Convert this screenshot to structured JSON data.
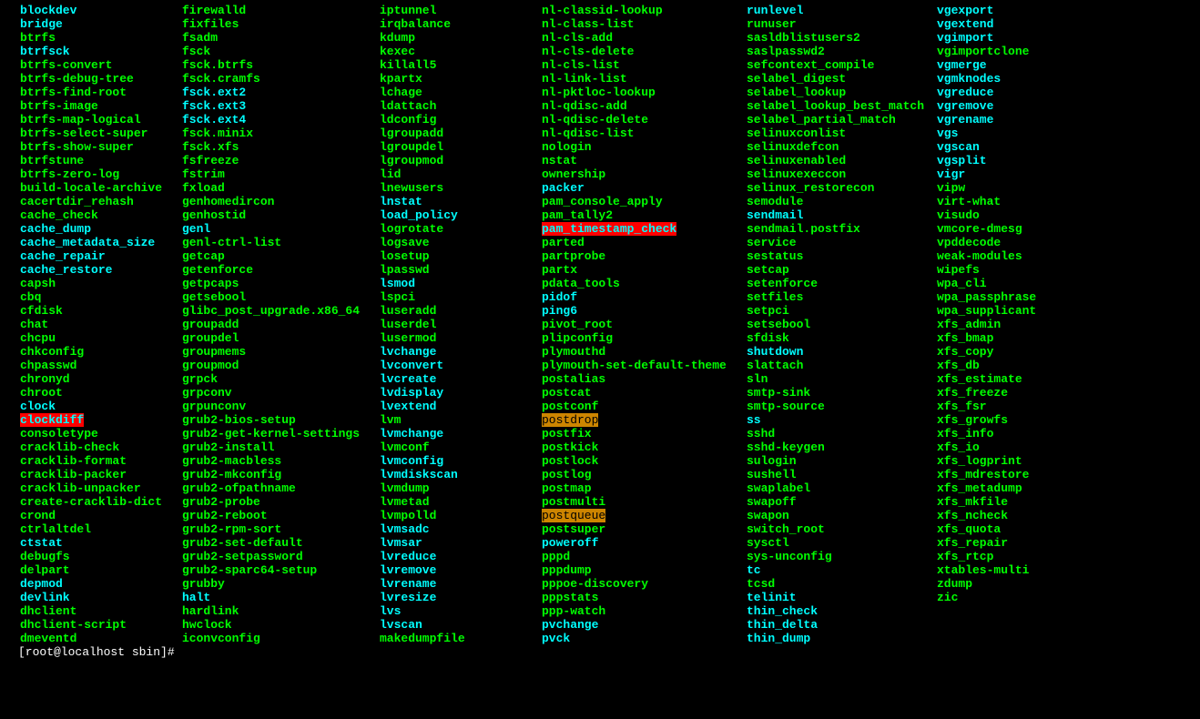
{
  "prompt": "[root@localhost sbin]#",
  "columns": [
    [
      {
        "t": "blockdev",
        "c": "cyan-bold"
      },
      {
        "t": "bridge",
        "c": "cyan-bold"
      },
      {
        "t": "btrfs",
        "c": "green-bold"
      },
      {
        "t": "btrfsck",
        "c": "cyan-bold"
      },
      {
        "t": "btrfs-convert",
        "c": "green-bold"
      },
      {
        "t": "btrfs-debug-tree",
        "c": "green-bold"
      },
      {
        "t": "btrfs-find-root",
        "c": "green-bold"
      },
      {
        "t": "btrfs-image",
        "c": "green-bold"
      },
      {
        "t": "btrfs-map-logical",
        "c": "green-bold"
      },
      {
        "t": "btrfs-select-super",
        "c": "green-bold"
      },
      {
        "t": "btrfs-show-super",
        "c": "green-bold"
      },
      {
        "t": "btrfstune",
        "c": "green-bold"
      },
      {
        "t": "btrfs-zero-log",
        "c": "green-bold"
      },
      {
        "t": "build-locale-archive",
        "c": "green-bold"
      },
      {
        "t": "cacertdir_rehash",
        "c": "green-bold"
      },
      {
        "t": "cache_check",
        "c": "green-bold"
      },
      {
        "t": "cache_dump",
        "c": "cyan-bold"
      },
      {
        "t": "cache_metadata_size",
        "c": "cyan-bold"
      },
      {
        "t": "cache_repair",
        "c": "cyan-bold"
      },
      {
        "t": "cache_restore",
        "c": "cyan-bold"
      },
      {
        "t": "capsh",
        "c": "green-bold"
      },
      {
        "t": "cbq",
        "c": "green-bold"
      },
      {
        "t": "cfdisk",
        "c": "green-bold"
      },
      {
        "t": "chat",
        "c": "green-bold"
      },
      {
        "t": "chcpu",
        "c": "green-bold"
      },
      {
        "t": "chkconfig",
        "c": "green-bold"
      },
      {
        "t": "chpasswd",
        "c": "green-bold"
      },
      {
        "t": "chronyd",
        "c": "green-bold"
      },
      {
        "t": "chroot",
        "c": "green-bold"
      },
      {
        "t": "clock",
        "c": "cyan-bold"
      },
      {
        "t": "clockdiff",
        "c": "cyan-bold",
        "bg": "on-red"
      },
      {
        "t": "consoletype",
        "c": "green-bold"
      },
      {
        "t": "cracklib-check",
        "c": "green-bold"
      },
      {
        "t": "cracklib-format",
        "c": "green-bold"
      },
      {
        "t": "cracklib-packer",
        "c": "green-bold"
      },
      {
        "t": "cracklib-unpacker",
        "c": "green-bold"
      },
      {
        "t": "create-cracklib-dict",
        "c": "green-bold"
      },
      {
        "t": "crond",
        "c": "green-bold"
      },
      {
        "t": "ctrlaltdel",
        "c": "green-bold"
      },
      {
        "t": "ctstat",
        "c": "cyan-bold"
      },
      {
        "t": "debugfs",
        "c": "green-bold"
      },
      {
        "t": "delpart",
        "c": "green-bold"
      },
      {
        "t": "depmod",
        "c": "cyan-bold"
      },
      {
        "t": "devlink",
        "c": "cyan-bold"
      },
      {
        "t": "dhclient",
        "c": "green-bold"
      },
      {
        "t": "dhclient-script",
        "c": "green-bold"
      },
      {
        "t": "dmeventd",
        "c": "green-bold"
      }
    ],
    [
      {
        "t": "firewalld",
        "c": "green-bold"
      },
      {
        "t": "fixfiles",
        "c": "green-bold"
      },
      {
        "t": "fsadm",
        "c": "green-bold"
      },
      {
        "t": "fsck",
        "c": "green-bold"
      },
      {
        "t": "fsck.btrfs",
        "c": "green-bold"
      },
      {
        "t": "fsck.cramfs",
        "c": "green-bold"
      },
      {
        "t": "fsck.ext2",
        "c": "cyan-bold"
      },
      {
        "t": "fsck.ext3",
        "c": "cyan-bold"
      },
      {
        "t": "fsck.ext4",
        "c": "cyan-bold"
      },
      {
        "t": "fsck.minix",
        "c": "green-bold"
      },
      {
        "t": "fsck.xfs",
        "c": "green-bold"
      },
      {
        "t": "fsfreeze",
        "c": "green-bold"
      },
      {
        "t": "fstrim",
        "c": "green-bold"
      },
      {
        "t": "fxload",
        "c": "green-bold"
      },
      {
        "t": "genhomedircon",
        "c": "green-bold"
      },
      {
        "t": "genhostid",
        "c": "green-bold"
      },
      {
        "t": "genl",
        "c": "cyan-bold"
      },
      {
        "t": "genl-ctrl-list",
        "c": "green-bold"
      },
      {
        "t": "getcap",
        "c": "green-bold"
      },
      {
        "t": "getenforce",
        "c": "green-bold"
      },
      {
        "t": "getpcaps",
        "c": "green-bold"
      },
      {
        "t": "getsebool",
        "c": "green-bold"
      },
      {
        "t": "glibc_post_upgrade.x86_64",
        "c": "green-bold"
      },
      {
        "t": "groupadd",
        "c": "green-bold"
      },
      {
        "t": "groupdel",
        "c": "green-bold"
      },
      {
        "t": "groupmems",
        "c": "green-bold"
      },
      {
        "t": "groupmod",
        "c": "green-bold"
      },
      {
        "t": "grpck",
        "c": "green-bold"
      },
      {
        "t": "grpconv",
        "c": "green-bold"
      },
      {
        "t": "grpunconv",
        "c": "green-bold"
      },
      {
        "t": "grub2-bios-setup",
        "c": "green-bold"
      },
      {
        "t": "grub2-get-kernel-settings",
        "c": "green-bold"
      },
      {
        "t": "grub2-install",
        "c": "green-bold"
      },
      {
        "t": "grub2-macbless",
        "c": "green-bold"
      },
      {
        "t": "grub2-mkconfig",
        "c": "green-bold"
      },
      {
        "t": "grub2-ofpathname",
        "c": "green-bold"
      },
      {
        "t": "grub2-probe",
        "c": "green-bold"
      },
      {
        "t": "grub2-reboot",
        "c": "green-bold"
      },
      {
        "t": "grub2-rpm-sort",
        "c": "green-bold"
      },
      {
        "t": "grub2-set-default",
        "c": "green-bold"
      },
      {
        "t": "grub2-setpassword",
        "c": "green-bold"
      },
      {
        "t": "grub2-sparc64-setup",
        "c": "green-bold"
      },
      {
        "t": "grubby",
        "c": "green-bold"
      },
      {
        "t": "halt",
        "c": "cyan-bold"
      },
      {
        "t": "hardlink",
        "c": "green-bold"
      },
      {
        "t": "hwclock",
        "c": "green-bold"
      },
      {
        "t": "iconvconfig",
        "c": "green-bold"
      }
    ],
    [
      {
        "t": "iptunnel",
        "c": "green-bold"
      },
      {
        "t": "irqbalance",
        "c": "green-bold"
      },
      {
        "t": "kdump",
        "c": "green-bold"
      },
      {
        "t": "kexec",
        "c": "green-bold"
      },
      {
        "t": "killall5",
        "c": "green-bold"
      },
      {
        "t": "kpartx",
        "c": "green-bold"
      },
      {
        "t": "lchage",
        "c": "green-bold"
      },
      {
        "t": "ldattach",
        "c": "green-bold"
      },
      {
        "t": "ldconfig",
        "c": "green-bold"
      },
      {
        "t": "lgroupadd",
        "c": "green-bold"
      },
      {
        "t": "lgroupdel",
        "c": "green-bold"
      },
      {
        "t": "lgroupmod",
        "c": "green-bold"
      },
      {
        "t": "lid",
        "c": "green-bold"
      },
      {
        "t": "lnewusers",
        "c": "green-bold"
      },
      {
        "t": "lnstat",
        "c": "cyan-bold"
      },
      {
        "t": "load_policy",
        "c": "cyan-bold"
      },
      {
        "t": "logrotate",
        "c": "green-bold"
      },
      {
        "t": "logsave",
        "c": "green-bold"
      },
      {
        "t": "losetup",
        "c": "green-bold"
      },
      {
        "t": "lpasswd",
        "c": "green-bold"
      },
      {
        "t": "lsmod",
        "c": "cyan-bold"
      },
      {
        "t": "lspci",
        "c": "green-bold"
      },
      {
        "t": "luseradd",
        "c": "green-bold"
      },
      {
        "t": "luserdel",
        "c": "green-bold"
      },
      {
        "t": "lusermod",
        "c": "green-bold"
      },
      {
        "t": "lvchange",
        "c": "cyan-bold"
      },
      {
        "t": "lvconvert",
        "c": "cyan-bold"
      },
      {
        "t": "lvcreate",
        "c": "cyan-bold"
      },
      {
        "t": "lvdisplay",
        "c": "cyan-bold"
      },
      {
        "t": "lvextend",
        "c": "cyan-bold"
      },
      {
        "t": "lvm",
        "c": "green-bold"
      },
      {
        "t": "lvmchange",
        "c": "cyan-bold"
      },
      {
        "t": "lvmconf",
        "c": "green-bold"
      },
      {
        "t": "lvmconfig",
        "c": "cyan-bold"
      },
      {
        "t": "lvmdiskscan",
        "c": "cyan-bold"
      },
      {
        "t": "lvmdump",
        "c": "green-bold"
      },
      {
        "t": "lvmetad",
        "c": "green-bold"
      },
      {
        "t": "lvmpolld",
        "c": "green-bold"
      },
      {
        "t": "lvmsadc",
        "c": "cyan-bold"
      },
      {
        "t": "lvmsar",
        "c": "cyan-bold"
      },
      {
        "t": "lvreduce",
        "c": "cyan-bold"
      },
      {
        "t": "lvremove",
        "c": "cyan-bold"
      },
      {
        "t": "lvrename",
        "c": "cyan-bold"
      },
      {
        "t": "lvresize",
        "c": "cyan-bold"
      },
      {
        "t": "lvs",
        "c": "cyan-bold"
      },
      {
        "t": "lvscan",
        "c": "cyan-bold"
      },
      {
        "t": "makedumpfile",
        "c": "green-bold"
      }
    ],
    [
      {
        "t": "nl-classid-lookup",
        "c": "green-bold"
      },
      {
        "t": "nl-class-list",
        "c": "green-bold"
      },
      {
        "t": "nl-cls-add",
        "c": "green-bold"
      },
      {
        "t": "nl-cls-delete",
        "c": "green-bold"
      },
      {
        "t": "nl-cls-list",
        "c": "green-bold"
      },
      {
        "t": "nl-link-list",
        "c": "green-bold"
      },
      {
        "t": "nl-pktloc-lookup",
        "c": "green-bold"
      },
      {
        "t": "nl-qdisc-add",
        "c": "green-bold"
      },
      {
        "t": "nl-qdisc-delete",
        "c": "green-bold"
      },
      {
        "t": "nl-qdisc-list",
        "c": "green-bold"
      },
      {
        "t": "nologin",
        "c": "green-bold"
      },
      {
        "t": "nstat",
        "c": "green-bold"
      },
      {
        "t": "ownership",
        "c": "green-bold"
      },
      {
        "t": "packer",
        "c": "cyan-bold"
      },
      {
        "t": "pam_console_apply",
        "c": "green-bold"
      },
      {
        "t": "pam_tally2",
        "c": "green-bold"
      },
      {
        "t": "pam_timestamp_check",
        "c": "cyan-bold",
        "bg": "on-red"
      },
      {
        "t": "parted",
        "c": "green-bold"
      },
      {
        "t": "partprobe",
        "c": "green-bold"
      },
      {
        "t": "partx",
        "c": "green-bold"
      },
      {
        "t": "pdata_tools",
        "c": "green-bold"
      },
      {
        "t": "pidof",
        "c": "cyan-bold"
      },
      {
        "t": "ping6",
        "c": "cyan-bold"
      },
      {
        "t": "pivot_root",
        "c": "green-bold"
      },
      {
        "t": "plipconfig",
        "c": "green-bold"
      },
      {
        "t": "plymouthd",
        "c": "green-bold"
      },
      {
        "t": "plymouth-set-default-theme",
        "c": "green-bold"
      },
      {
        "t": "postalias",
        "c": "green-bold"
      },
      {
        "t": "postcat",
        "c": "green-bold"
      },
      {
        "t": "postconf",
        "c": "green-bold"
      },
      {
        "t": "postdrop",
        "c": "",
        "bg": "on-orange"
      },
      {
        "t": "postfix",
        "c": "green-bold"
      },
      {
        "t": "postkick",
        "c": "green-bold"
      },
      {
        "t": "postlock",
        "c": "green-bold"
      },
      {
        "t": "postlog",
        "c": "green-bold"
      },
      {
        "t": "postmap",
        "c": "green-bold"
      },
      {
        "t": "postmulti",
        "c": "green-bold"
      },
      {
        "t": "postqueue",
        "c": "",
        "bg": "on-orange"
      },
      {
        "t": "postsuper",
        "c": "green-bold"
      },
      {
        "t": "poweroff",
        "c": "cyan-bold"
      },
      {
        "t": "pppd",
        "c": "green-bold"
      },
      {
        "t": "pppdump",
        "c": "green-bold"
      },
      {
        "t": "pppoe-discovery",
        "c": "green-bold"
      },
      {
        "t": "pppstats",
        "c": "green-bold"
      },
      {
        "t": "ppp-watch",
        "c": "green-bold"
      },
      {
        "t": "pvchange",
        "c": "cyan-bold"
      },
      {
        "t": "pvck",
        "c": "cyan-bold"
      }
    ],
    [
      {
        "t": "runlevel",
        "c": "cyan-bold"
      },
      {
        "t": "runuser",
        "c": "green-bold"
      },
      {
        "t": "sasldblistusers2",
        "c": "green-bold"
      },
      {
        "t": "saslpasswd2",
        "c": "green-bold"
      },
      {
        "t": "sefcontext_compile",
        "c": "green-bold"
      },
      {
        "t": "selabel_digest",
        "c": "green-bold"
      },
      {
        "t": "selabel_lookup",
        "c": "green-bold"
      },
      {
        "t": "selabel_lookup_best_match",
        "c": "green-bold"
      },
      {
        "t": "selabel_partial_match",
        "c": "green-bold"
      },
      {
        "t": "selinuxconlist",
        "c": "green-bold"
      },
      {
        "t": "selinuxdefcon",
        "c": "green-bold"
      },
      {
        "t": "selinuxenabled",
        "c": "green-bold"
      },
      {
        "t": "selinuxexeccon",
        "c": "green-bold"
      },
      {
        "t": "selinux_restorecon",
        "c": "green-bold"
      },
      {
        "t": "semodule",
        "c": "green-bold"
      },
      {
        "t": "sendmail",
        "c": "cyan-bold"
      },
      {
        "t": "sendmail.postfix",
        "c": "green-bold"
      },
      {
        "t": "service",
        "c": "green-bold"
      },
      {
        "t": "sestatus",
        "c": "green-bold"
      },
      {
        "t": "setcap",
        "c": "green-bold"
      },
      {
        "t": "setenforce",
        "c": "green-bold"
      },
      {
        "t": "setfiles",
        "c": "green-bold"
      },
      {
        "t": "setpci",
        "c": "green-bold"
      },
      {
        "t": "setsebool",
        "c": "green-bold"
      },
      {
        "t": "sfdisk",
        "c": "green-bold"
      },
      {
        "t": "shutdown",
        "c": "cyan-bold"
      },
      {
        "t": "slattach",
        "c": "green-bold"
      },
      {
        "t": "sln",
        "c": "green-bold"
      },
      {
        "t": "smtp-sink",
        "c": "green-bold"
      },
      {
        "t": "smtp-source",
        "c": "green-bold"
      },
      {
        "t": "ss",
        "c": "cyan-bold"
      },
      {
        "t": "sshd",
        "c": "green-bold"
      },
      {
        "t": "sshd-keygen",
        "c": "green-bold"
      },
      {
        "t": "sulogin",
        "c": "green-bold"
      },
      {
        "t": "sushell",
        "c": "green-bold"
      },
      {
        "t": "swaplabel",
        "c": "green-bold"
      },
      {
        "t": "swapoff",
        "c": "green-bold"
      },
      {
        "t": "swapon",
        "c": "green-bold"
      },
      {
        "t": "switch_root",
        "c": "green-bold"
      },
      {
        "t": "sysctl",
        "c": "green-bold"
      },
      {
        "t": "sys-unconfig",
        "c": "green-bold"
      },
      {
        "t": "tc",
        "c": "cyan-bold"
      },
      {
        "t": "tcsd",
        "c": "green-bold"
      },
      {
        "t": "telinit",
        "c": "cyan-bold"
      },
      {
        "t": "thin_check",
        "c": "cyan-bold"
      },
      {
        "t": "thin_delta",
        "c": "cyan-bold"
      },
      {
        "t": "thin_dump",
        "c": "cyan-bold"
      }
    ],
    [
      {
        "t": "vgexport",
        "c": "cyan-bold"
      },
      {
        "t": "vgextend",
        "c": "cyan-bold"
      },
      {
        "t": "vgimport",
        "c": "cyan-bold"
      },
      {
        "t": "vgimportclone",
        "c": "green-bold"
      },
      {
        "t": "vgmerge",
        "c": "cyan-bold"
      },
      {
        "t": "vgmknodes",
        "c": "cyan-bold"
      },
      {
        "t": "vgreduce",
        "c": "cyan-bold"
      },
      {
        "t": "vgremove",
        "c": "cyan-bold"
      },
      {
        "t": "vgrename",
        "c": "cyan-bold"
      },
      {
        "t": "vgs",
        "c": "cyan-bold"
      },
      {
        "t": "vgscan",
        "c": "cyan-bold"
      },
      {
        "t": "vgsplit",
        "c": "cyan-bold"
      },
      {
        "t": "vigr",
        "c": "cyan-bold"
      },
      {
        "t": "vipw",
        "c": "green-bold"
      },
      {
        "t": "virt-what",
        "c": "green-bold"
      },
      {
        "t": "visudo",
        "c": "green-bold"
      },
      {
        "t": "vmcore-dmesg",
        "c": "green-bold"
      },
      {
        "t": "vpddecode",
        "c": "green-bold"
      },
      {
        "t": "weak-modules",
        "c": "green-bold"
      },
      {
        "t": "wipefs",
        "c": "green-bold"
      },
      {
        "t": "wpa_cli",
        "c": "green-bold"
      },
      {
        "t": "wpa_passphrase",
        "c": "green-bold"
      },
      {
        "t": "wpa_supplicant",
        "c": "green-bold"
      },
      {
        "t": "xfs_admin",
        "c": "green-bold"
      },
      {
        "t": "xfs_bmap",
        "c": "green-bold"
      },
      {
        "t": "xfs_copy",
        "c": "green-bold"
      },
      {
        "t": "xfs_db",
        "c": "green-bold"
      },
      {
        "t": "xfs_estimate",
        "c": "green-bold"
      },
      {
        "t": "xfs_freeze",
        "c": "green-bold"
      },
      {
        "t": "xfs_fsr",
        "c": "green-bold"
      },
      {
        "t": "xfs_growfs",
        "c": "green-bold"
      },
      {
        "t": "xfs_info",
        "c": "green-bold"
      },
      {
        "t": "xfs_io",
        "c": "green-bold"
      },
      {
        "t": "xfs_logprint",
        "c": "green-bold"
      },
      {
        "t": "xfs_mdrestore",
        "c": "green-bold"
      },
      {
        "t": "xfs_metadump",
        "c": "green-bold"
      },
      {
        "t": "xfs_mkfile",
        "c": "green-bold"
      },
      {
        "t": "xfs_ncheck",
        "c": "green-bold"
      },
      {
        "t": "xfs_quota",
        "c": "green-bold"
      },
      {
        "t": "xfs_repair",
        "c": "green-bold"
      },
      {
        "t": "xfs_rtcp",
        "c": "green-bold"
      },
      {
        "t": "xtables-multi",
        "c": "green-bold"
      },
      {
        "t": "zdump",
        "c": "green-bold"
      },
      {
        "t": "zic",
        "c": "green-bold"
      }
    ]
  ]
}
